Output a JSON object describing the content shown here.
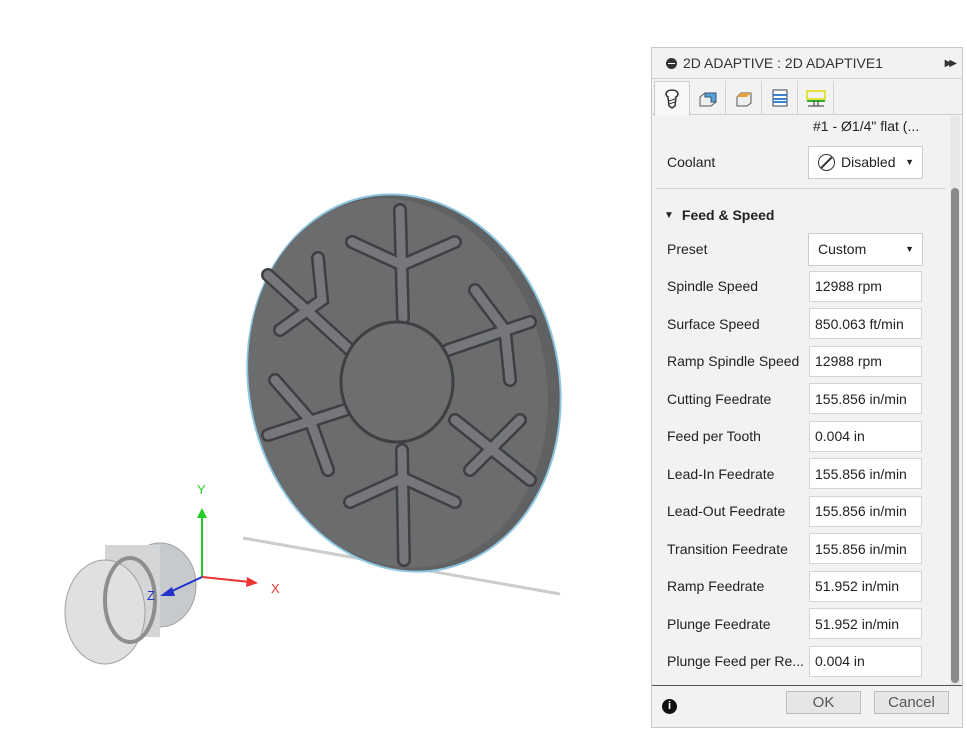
{
  "viewport": {
    "axes": {
      "x": "X",
      "y": "Y",
      "z": "Z"
    },
    "viewcube_label": "Y"
  },
  "panel": {
    "title": "2D ADAPTIVE : 2D ADAPTIVE1",
    "tabs": [
      {
        "name": "tool-icon"
      },
      {
        "name": "geometry-icon"
      },
      {
        "name": "heights-icon"
      },
      {
        "name": "passes-icon"
      },
      {
        "name": "linking-icon"
      }
    ],
    "tool_text": "#1 - Ø1/4\" flat (...",
    "coolant": {
      "label": "Coolant",
      "value": "Disabled"
    },
    "section": "Feed & Speed",
    "preset": {
      "label": "Preset",
      "value": "Custom"
    },
    "fields": [
      {
        "label": "Spindle Speed",
        "value": "12988 rpm"
      },
      {
        "label": "Surface Speed",
        "value": "850.063 ft/min"
      },
      {
        "label": "Ramp Spindle Speed",
        "value": "12988 rpm"
      },
      {
        "label": "Cutting Feedrate",
        "value": "155.856 in/min"
      },
      {
        "label": "Feed per Tooth",
        "value": "0.004 in"
      },
      {
        "label": "Lead-In Feedrate",
        "value": "155.856 in/min"
      },
      {
        "label": "Lead-Out Feedrate",
        "value": "155.856 in/min"
      },
      {
        "label": "Transition Feedrate",
        "value": "155.856 in/min"
      },
      {
        "label": "Ramp Feedrate",
        "value": "51.952 in/min"
      },
      {
        "label": "Plunge Feedrate",
        "value": "51.952 in/min"
      },
      {
        "label": "Plunge Feed per Re...",
        "value": "0.004 in"
      }
    ],
    "ok": "OK",
    "cancel": "Cancel"
  }
}
